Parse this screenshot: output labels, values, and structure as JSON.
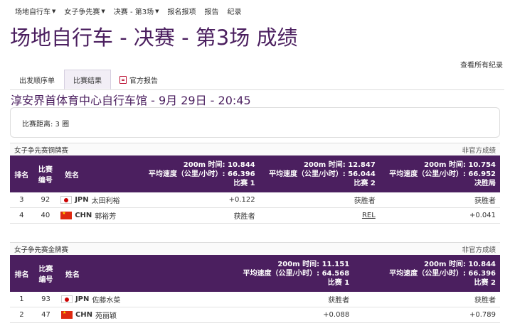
{
  "nav": {
    "items": [
      {
        "label": "场地自行车",
        "dropdown": true
      },
      {
        "label": "女子争先赛",
        "dropdown": true
      },
      {
        "label": "决赛 - 第3场",
        "dropdown": true
      },
      {
        "label": "报名报项",
        "dropdown": false
      },
      {
        "label": "报告",
        "dropdown": false
      },
      {
        "label": "纪录",
        "dropdown": false
      }
    ]
  },
  "page_title": "场地自行车 - 决赛 - 第3场 成绩",
  "all_records_link": "查看所有纪录",
  "tabs": [
    {
      "label": "出发顺序单",
      "active": false
    },
    {
      "label": "比赛结果",
      "active": true
    },
    {
      "label": "官方报告",
      "active": false,
      "icon": "pdf-icon"
    }
  ],
  "venue_line": "淳安界首体育中心自行车馆 - 9月 29日 - 20:45",
  "race_distance": "比赛距离: 3 圈",
  "panels": [
    {
      "title": "女子争先赛铜牌赛",
      "status": "非官方成绩",
      "headers": {
        "rank": "排名",
        "bib_line1": "比赛",
        "bib_line2": "编号",
        "name": "姓名",
        "heats": [
          {
            "line1": "200m 时间: 10.844",
            "line2": "平均速度（公里/小时）: 66.396",
            "line3": "比赛 1"
          },
          {
            "line1": "200m 时间: 12.847",
            "line2": "平均速度（公里/小时）: 56.044",
            "line3": "比赛 2"
          },
          {
            "line1": "200m 时间: 10.754",
            "line2": "平均速度（公里/小时）: 66.952",
            "line3": "决胜局"
          }
        ]
      },
      "rows": [
        {
          "rank": "3",
          "bib": "92",
          "flag": "jpn",
          "noc": "JPN",
          "name": "太田利裕",
          "results": [
            "+0.122",
            "获胜者",
            "获胜者"
          ]
        },
        {
          "rank": "4",
          "bib": "40",
          "flag": "chn",
          "noc": "CHN",
          "name": "郭裕芳",
          "results": [
            "获胜者",
            "REL",
            "+0.041"
          ]
        }
      ]
    },
    {
      "title": "女子争先赛金牌赛",
      "status": "非官方成绩",
      "headers": {
        "rank": "排名",
        "bib_line1": "比赛",
        "bib_line2": "编号",
        "name": "姓名",
        "heats": [
          {
            "line1": "200m 时间: 11.151",
            "line2": "平均速度（公里/小时）: 64.568",
            "line3": "比赛 1"
          },
          {
            "line1": "200m 时间: 10.844",
            "line2": "平均速度（公里/小时）: 66.396",
            "line3": "比赛 2"
          }
        ]
      },
      "rows": [
        {
          "rank": "1",
          "bib": "93",
          "flag": "jpn",
          "noc": "JPN",
          "name": "佐藤水菜",
          "results": [
            "获胜者",
            "获胜者"
          ]
        },
        {
          "rank": "2",
          "bib": "47",
          "flag": "chn",
          "noc": "CHN",
          "name": "苑丽颖",
          "results": [
            "+0.088",
            "+0.789"
          ]
        }
      ]
    }
  ]
}
